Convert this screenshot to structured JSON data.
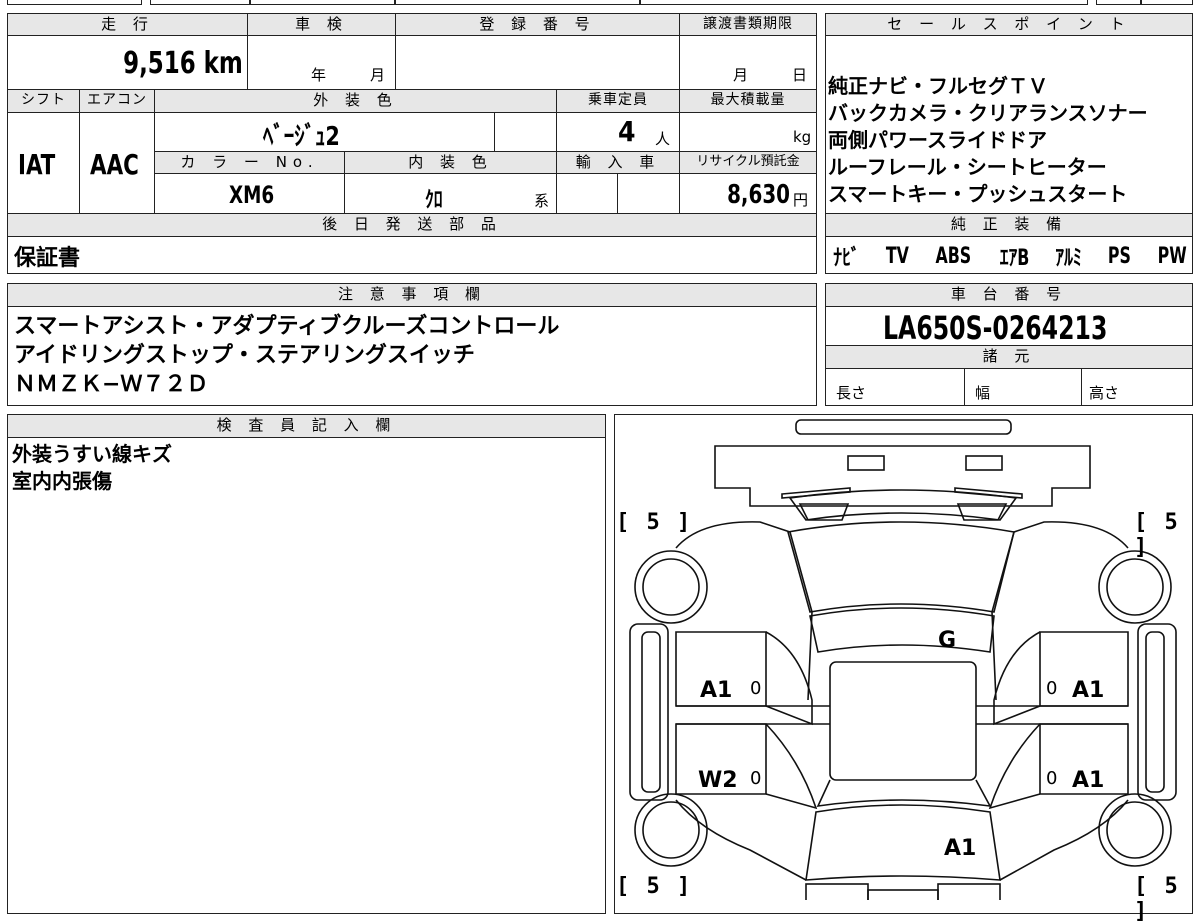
{
  "vehicle": {
    "header_mileage": "走 行",
    "mileage": "9,516 km",
    "header_inspection": "車 検",
    "inspection_year_unit": "年",
    "inspection_month_unit": "月",
    "header_registration": "登 録 番 号",
    "header_transfer_deadline": "譲渡書類期限",
    "transfer_month_unit": "月",
    "transfer_day_unit": "日",
    "header_shift": "シフト",
    "shift": "IAT",
    "header_aircon": "エアコン",
    "aircon": "AAC",
    "header_exterior_color": "外 装 色",
    "exterior_color": "ﾍﾞｰｼﾞｭ2",
    "header_color_no": "カ ラ ー No.",
    "color_no": "XM6",
    "header_interior_color": "内 装 色",
    "interior_color": "ｸﾛ",
    "interior_color_suffix": "系",
    "header_capacity": "乗車定員",
    "capacity": "4",
    "capacity_unit": "人",
    "header_max_load": "最大積載量",
    "max_load_unit": "kg",
    "header_import": "輸 入 車",
    "header_recycle": "リサイクル預託金",
    "recycle_fee": "8,630",
    "recycle_unit": "円"
  },
  "sales_points": {
    "header": "セ ー ル ス ポ イ ン ト",
    "lines": [
      "純正ナビ・フルセグＴＶ",
      "バックカメラ・クリアランスソナー",
      "両側パワースライドドア",
      "ルーフレール・シートヒーター",
      "スマートキー・プッシュスタート"
    ]
  },
  "later_parts": {
    "header": "後 日 発 送 部 品",
    "value": "保証書"
  },
  "factory_equipment": {
    "header": "純 正 装 備",
    "items": [
      "ﾅﾋﾞ",
      "TV",
      "ABS",
      "ｴｱB",
      "ｱﾙﾐ",
      "PS",
      "PW"
    ]
  },
  "notes": {
    "header": "注 意 事 項 欄",
    "lines": [
      "スマートアシスト・アダプティブクルーズコントロール",
      "アイドリングストップ・ステアリングスイッチ",
      "ＮＭＺＫ−Ｗ７２Ｄ"
    ]
  },
  "chassis": {
    "header": "車 台 番 号",
    "number": "LA650S-0264213",
    "spec_header": "諸 元",
    "length_label": "長さ",
    "width_label": "幅",
    "height_label": "高さ"
  },
  "inspector": {
    "header": "検 査 員 記 入 欄",
    "lines": [
      "外装うすい線キズ",
      "室内内張傷"
    ]
  },
  "diagram": {
    "tire_tl": "[ 5 ]",
    "tire_tr": "[ 5 ]",
    "tire_bl": "[ 5 ]",
    "tire_br": "[ 5 ]",
    "windshield": "G",
    "front_left_door": "A1",
    "front_right_door": "A1",
    "rear_left_door": "W2",
    "rear_right_door": "A1",
    "roof_rear": "A1",
    "door_mark": "0"
  }
}
